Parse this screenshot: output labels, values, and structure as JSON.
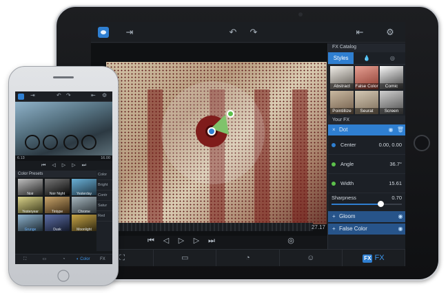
{
  "ipad": {
    "toolbar": {
      "app_icon": "camera-lens-icon",
      "import_icon": "import-icon",
      "undo_icon": "undo-icon",
      "redo_icon": "redo-icon",
      "export_icon": "export-icon",
      "settings_icon": "gear-icon"
    },
    "time_label": "27.17",
    "transport": [
      "camera-icon",
      "frame-back-icon",
      "play-icon",
      "frame-forward-icon",
      "jump-end-icon",
      "snapshot-icon"
    ],
    "bottom_tabs": [
      {
        "icon": "crop-icon",
        "label": ""
      },
      {
        "icon": "presentation-icon",
        "label": ""
      },
      {
        "icon": "speed-icon",
        "label": ""
      },
      {
        "icon": "mask-icon",
        "label": ""
      },
      {
        "icon": "fx-icon",
        "label": "FX",
        "active": true
      }
    ],
    "panel": {
      "title": "FX Catalog",
      "segments": [
        "Styles",
        "",
        ""
      ],
      "styles": [
        "Abstract",
        "False Color",
        "Comic",
        "Pointillize",
        "Seurat",
        "Screen"
      ],
      "your_fx_title": "Your FX",
      "active_fx": "Dot",
      "properties": [
        {
          "name": "Center",
          "value": "0.00, 0.00",
          "color": "#2f7fd1"
        },
        {
          "name": "Angle",
          "value": "36.7°",
          "color": "#5cc14b"
        },
        {
          "name": "Width",
          "value": "15.61",
          "color": "#5cc14b"
        }
      ],
      "sharpness": {
        "name": "Sharpness",
        "value": "0.70",
        "level": 0.7
      },
      "stack": [
        "Gloom",
        "False Color"
      ]
    }
  },
  "iphone": {
    "time_start": "6.13",
    "time_end": "16.00",
    "presets_title": "Color Presets",
    "presets": [
      "Noir",
      "Noir Night",
      "Yesterday",
      "Yesteryear",
      "Tintype",
      "Chrome",
      "Grunge",
      "Dusk",
      "Moonlight"
    ],
    "selected_preset": "Grunge",
    "side_labels": [
      "Color",
      "Bright",
      "Contr",
      "Satur",
      "Red"
    ],
    "bottom_tabs": [
      "",
      "",
      "",
      "Color",
      "FX"
    ],
    "active_tab": "Color"
  },
  "colors": {
    "accent": "#2f7fd1",
    "green_handle": "#5cc14b",
    "halftone": "#7f1c1b"
  }
}
